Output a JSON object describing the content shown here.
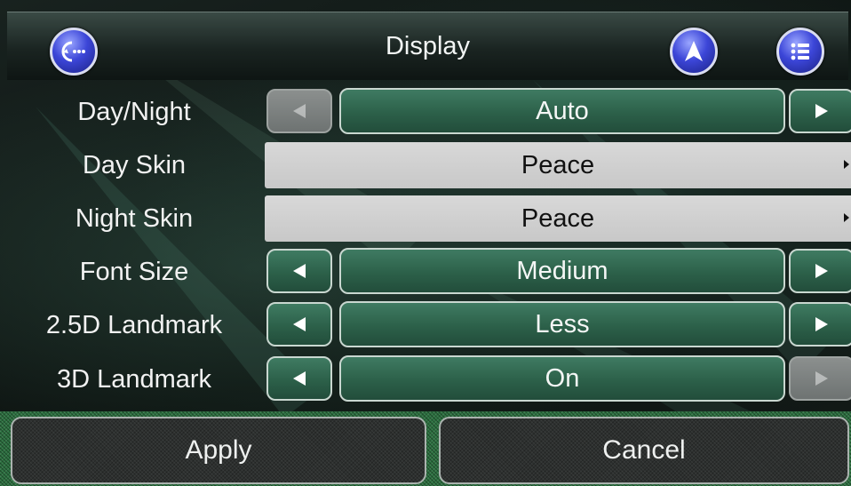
{
  "header": {
    "title": "Display",
    "back_icon": "back-more-icon",
    "navigate_icon": "navigation-arrow-icon",
    "menu_icon": "menu-list-icon"
  },
  "settings": [
    {
      "label": "Day/Night",
      "value": "Auto",
      "type": "selector",
      "prev_enabled": false,
      "next_enabled": true
    },
    {
      "label": "Day Skin",
      "value": "Peace",
      "type": "list"
    },
    {
      "label": "Night Skin",
      "value": "Peace",
      "type": "list"
    },
    {
      "label": "Font Size",
      "value": "Medium",
      "type": "selector",
      "prev_enabled": true,
      "next_enabled": true
    },
    {
      "label": "2.5D Landmark",
      "value": "Less",
      "type": "selector",
      "prev_enabled": true,
      "next_enabled": true
    },
    {
      "label": "3D Landmark",
      "value": "On",
      "type": "selector",
      "prev_enabled": true,
      "next_enabled": false
    }
  ],
  "footer": {
    "apply_label": "Apply",
    "cancel_label": "Cancel"
  },
  "colors": {
    "accent_green": "#2c6049",
    "button_blue": "#3c46d8",
    "footer_green": "#2b6f3f"
  }
}
